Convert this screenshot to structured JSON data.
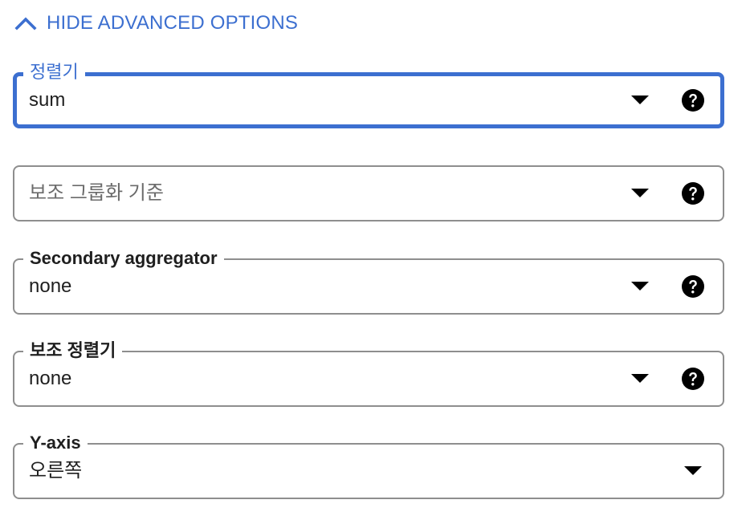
{
  "toggle": {
    "label": "HIDE ADVANCED OPTIONS",
    "icon": "chevron-up-icon"
  },
  "colors": {
    "accent": "#3c6fd0",
    "border": "#8e8e8e",
    "text": "#1f1f1f",
    "placeholder": "#6b6b6b"
  },
  "fields": [
    {
      "label": "정렬기",
      "value": "sum",
      "placeholder": "",
      "focused": true,
      "help_icon": "help-circle-icon",
      "dropdown_icon": "dropdown-arrow-icon"
    },
    {
      "label": "",
      "value": "",
      "placeholder": "보조 그룹화 기준",
      "focused": false,
      "help_icon": "help-circle-icon",
      "dropdown_icon": "dropdown-arrow-icon"
    },
    {
      "label": "Secondary aggregator",
      "value": "none",
      "placeholder": "",
      "focused": false,
      "help_icon": "help-circle-icon",
      "dropdown_icon": "dropdown-arrow-icon"
    },
    {
      "label": "보조 정렬기",
      "value": "none",
      "placeholder": "",
      "focused": false,
      "help_icon": "help-circle-icon",
      "dropdown_icon": "dropdown-arrow-icon"
    },
    {
      "label": "Y-axis",
      "value": "오른쪽",
      "placeholder": "",
      "focused": false,
      "dropdown_icon": "dropdown-arrow-icon"
    }
  ]
}
